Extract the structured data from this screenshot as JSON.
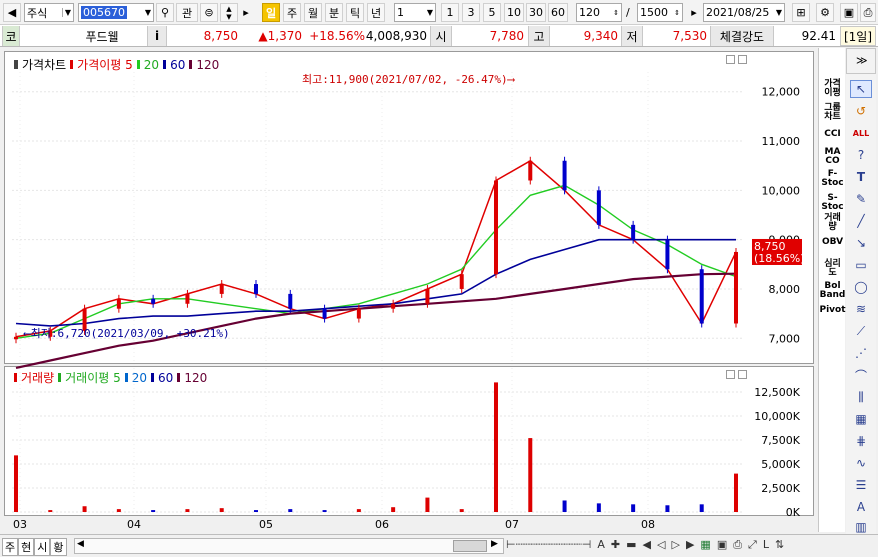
{
  "toolbar": {
    "market": "주식",
    "code": "005670",
    "btn_gwan": "관",
    "period_day": "일",
    "period_week": "주",
    "period_month": "월",
    "period_min": "분",
    "period_tick": "틱",
    "period_year": "년",
    "interval_value": "1",
    "minutes": [
      "1",
      "3",
      "5",
      "10",
      "30",
      "60"
    ],
    "count": "120",
    "total": "1500",
    "date": "2021/08/25"
  },
  "info": {
    "type_label": "코",
    "name": "푸드웰",
    "info_icon": "i",
    "price": "8,750",
    "change": "▲1,370",
    "change_pct": "+18.56%",
    "volume": "4,008,930",
    "open_label": "시",
    "open": "7,780",
    "high_label": "고",
    "high": "9,340",
    "low_label": "저",
    "low": "7,530",
    "strength_label": "체결강도",
    "strength": "92.41",
    "period_badge": "[1일]"
  },
  "price_chart": {
    "legend_price": "가격차트",
    "legend_ma": "가격이평 5",
    "legend_20": "20",
    "legend_60": "60",
    "legend_120": "120",
    "y_ticks": [
      "12,000",
      "11,000",
      "10,000",
      "9,000",
      "8,000",
      "7,000"
    ],
    "max_annotation": "최고:11,900(2021/07/02, -26.47%)",
    "min_annotation": "최저:6,720(2021/03/09, +30.21%)",
    "current_price": "8,750",
    "current_pct": "(18.56%)"
  },
  "volume_chart": {
    "legend_vol": "거래량",
    "legend_ma": "거래이평 5",
    "legend_20": "20",
    "legend_60": "60",
    "legend_120": "120",
    "y_ticks": [
      "12,500K",
      "10,000K",
      "7,500K",
      "5,000K",
      "2,500K",
      "0K"
    ]
  },
  "x_ticks": [
    "03",
    "04",
    "05",
    "06",
    "07",
    "08"
  ],
  "sidebar": [
    "가격\n이평",
    "그룹\n차트",
    "CCI",
    "MA\nCO",
    "F-\nStoc",
    "S-\nStoc",
    "거래\n량",
    "OBV",
    "심리\n도",
    "Bol\nBand",
    "Pivot"
  ],
  "bottom_tabs": [
    "주",
    "현",
    "시",
    "황"
  ],
  "colors": {
    "up": "#dd0000",
    "down": "#0000cc",
    "ma5": "#e00000",
    "ma20": "#22cc22",
    "ma60": "#000099",
    "ma120": "#660033",
    "accent_day": "#f5c400"
  },
  "chart_data": {
    "type": "line",
    "title": "",
    "x_labels": [
      "03",
      "04",
      "05",
      "06",
      "07",
      "08"
    ],
    "ylim": [
      6600,
      12400
    ],
    "series": [
      {
        "name": "5",
        "values": [
          7030,
          7150,
          7600,
          7800,
          7700,
          7900,
          8100,
          7900,
          7600,
          7400,
          7600,
          7700,
          8000,
          8300,
          10200,
          10600,
          10000,
          9300,
          9000,
          8400,
          7300,
          8750
        ]
      },
      {
        "name": "20",
        "values": [
          7000,
          7100,
          7400,
          7700,
          7800,
          7800,
          7700,
          7600,
          7500,
          7600,
          7700,
          7900,
          8100,
          8400,
          9200,
          9900,
          10100,
          9700,
          9200,
          8900,
          8500,
          8250
        ]
      },
      {
        "name": "60",
        "values": [
          7300,
          7250,
          7300,
          7400,
          7450,
          7450,
          7500,
          7550,
          7550,
          7600,
          7650,
          7700,
          7800,
          7900,
          8300,
          8600,
          8800,
          9000,
          9000,
          9000,
          9000,
          9000
        ]
      },
      {
        "name": "120",
        "values": [
          6400,
          6550,
          6700,
          6850,
          6950,
          7100,
          7250,
          7400,
          7500,
          7550,
          7600,
          7650,
          7700,
          7750,
          7800,
          7900,
          8000,
          8100,
          8200,
          8250,
          8300,
          8310
        ]
      }
    ],
    "volume_ylim": [
      0,
      13750000
    ],
    "volume": {
      "name": "거래량",
      "values": [
        5900000,
        200000,
        600000,
        300000,
        200000,
        300000,
        400000,
        200000,
        300000,
        200000,
        300000,
        500000,
        1500000,
        300000,
        13500000,
        7700000,
        1200000,
        900000,
        800000,
        700000,
        800000,
        4000000
      ]
    }
  }
}
